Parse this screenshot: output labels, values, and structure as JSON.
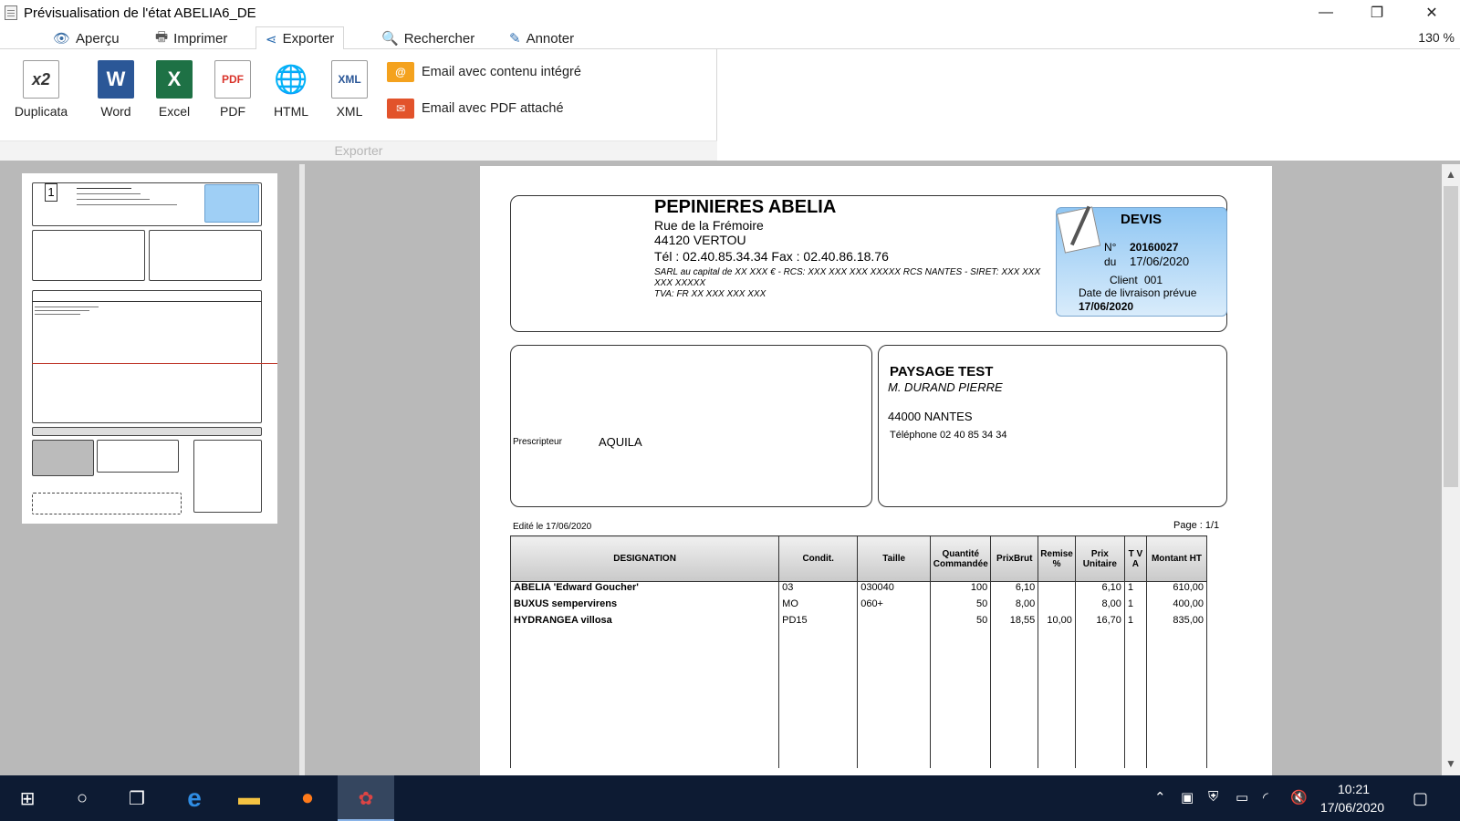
{
  "window": {
    "title": "Prévisualisation de l'état ABELIA6_DE",
    "minimize": "—",
    "maximize": "❐",
    "close": "✕"
  },
  "tabs": [
    {
      "label": "Aperçu",
      "icon": "eye-icon"
    },
    {
      "label": "Imprimer",
      "icon": "printer-icon"
    },
    {
      "label": "Exporter",
      "icon": "share-icon"
    },
    {
      "label": "Rechercher",
      "icon": "search-icon"
    },
    {
      "label": "Annoter",
      "icon": "pencil-icon"
    }
  ],
  "zoom": "130 %",
  "ribbon": {
    "buttons": [
      {
        "label": "Duplicata",
        "glyph": "x2"
      },
      {
        "label": "Word",
        "glyph": "W"
      },
      {
        "label": "Excel",
        "glyph": "X"
      },
      {
        "label": "PDF",
        "glyph": "PDF"
      },
      {
        "label": "HTML",
        "glyph": "🌐"
      },
      {
        "label": "XML",
        "glyph": "XML"
      }
    ],
    "email_integre": "Email avec contenu intégré",
    "email_pdf": "Email avec PDF attaché",
    "group_label": "Exporter",
    "colors": {
      "word": "#2b5797",
      "excel": "#1e7145",
      "pdf": "#d9342b",
      "email": "#f4a21e"
    }
  },
  "thumbnail": {
    "page_number": "1"
  },
  "document": {
    "company": {
      "name": "PEPINIERES ABELIA",
      "street": "Rue de la Frémoire",
      "city": "44120 VERTOU",
      "tel": "Tél : 02.40.85.34.34   Fax : 02.40.86.18.76",
      "legal1": "SARL au capital de XX XXX € - RCS: XXX XXX XXX XXXXX RCS NANTES - SIRET: XXX XXX XXX XXXXX",
      "legal2": "TVA: FR XX XXX XXX XXX"
    },
    "devis": {
      "title": "DEVIS",
      "num_label": "N°",
      "num": "20160027",
      "du_label": "du",
      "date": "17/06/2020",
      "client_label": "Client",
      "client": "001",
      "livraison_label": "Date de livraison prévue",
      "livraison": "17/06/2020"
    },
    "prescripteur_label": "Prescripteur",
    "prescripteur": "AQUILA",
    "client": {
      "name": "PAYSAGE TEST",
      "contact": "M. DURAND PIERRE",
      "city": "44000 NANTES",
      "phone": "Téléphone 02 40 85 34 34"
    },
    "edit_date": "Edité le 17/06/2020",
    "page": "Page : 1/1",
    "table": {
      "headers": [
        "DESIGNATION",
        "Condit.",
        "Taille",
        "Quantité Commandée",
        "PrixBrut",
        "Remise %",
        "Prix Unitaire",
        "T V A",
        "Montant HT"
      ],
      "rows": [
        [
          "ABELIA 'Edward Goucher'",
          "03",
          "030040",
          "100",
          "6,10",
          "",
          "6,10",
          "1",
          "610,00"
        ],
        [
          "BUXUS sempervirens",
          "MO",
          "060+",
          "50",
          "8,00",
          "",
          "8,00",
          "1",
          "400,00"
        ],
        [
          "HYDRANGEA villosa",
          "PD15",
          "",
          "50",
          "18,55",
          "10,00",
          "16,70",
          "1",
          "835,00"
        ]
      ]
    }
  },
  "taskbar": {
    "time": "10:21",
    "date": "17/06/2020"
  }
}
